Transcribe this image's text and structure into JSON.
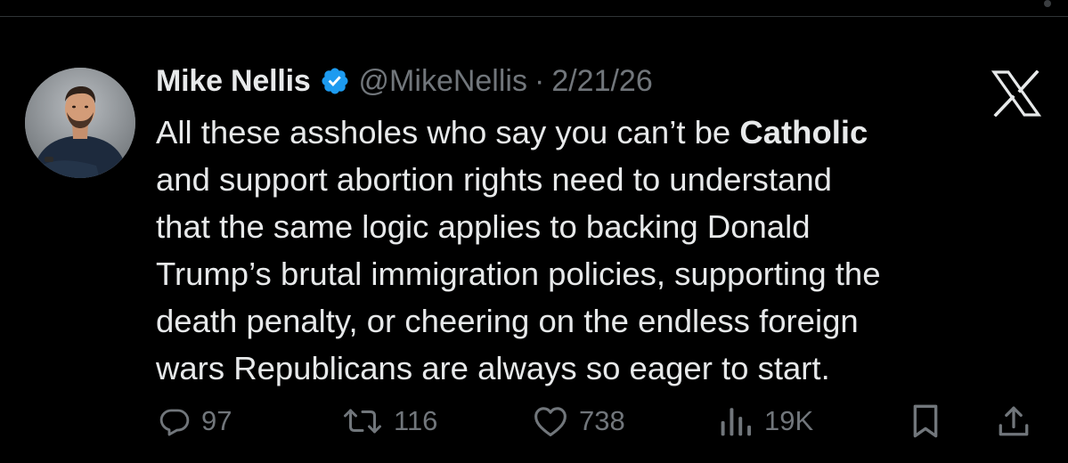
{
  "author": {
    "name": "Mike Nellis",
    "handle": "@MikeNellis",
    "separator": "·",
    "date": "2/21/26",
    "verified": true
  },
  "tweet": {
    "lines": [
      {
        "pre": "All these assholes who say you can’t be ",
        "bold": "Catholic"
      },
      {
        "text": "and support abortion rights need to understand"
      },
      {
        "text": "that the same logic applies to backing Donald"
      },
      {
        "text": "Trump’s brutal immigration policies, supporting the"
      },
      {
        "text": "death penalty, or cheering on the endless foreign"
      },
      {
        "text": "wars Republicans are always so eager to start."
      }
    ]
  },
  "actions": {
    "replies": "97",
    "reposts": "116",
    "likes": "738",
    "views": "19K"
  },
  "icons": {
    "verified": "verified-badge-icon",
    "platform": "x-logo-icon",
    "reply": "reply-icon",
    "repost": "repost-icon",
    "like": "heart-icon",
    "views": "views-icon",
    "bookmark": "bookmark-icon",
    "share": "share-icon"
  },
  "colors": {
    "background": "#000000",
    "text": "#e7e9ea",
    "muted": "#71767b",
    "verified": "#1d9bf0"
  }
}
